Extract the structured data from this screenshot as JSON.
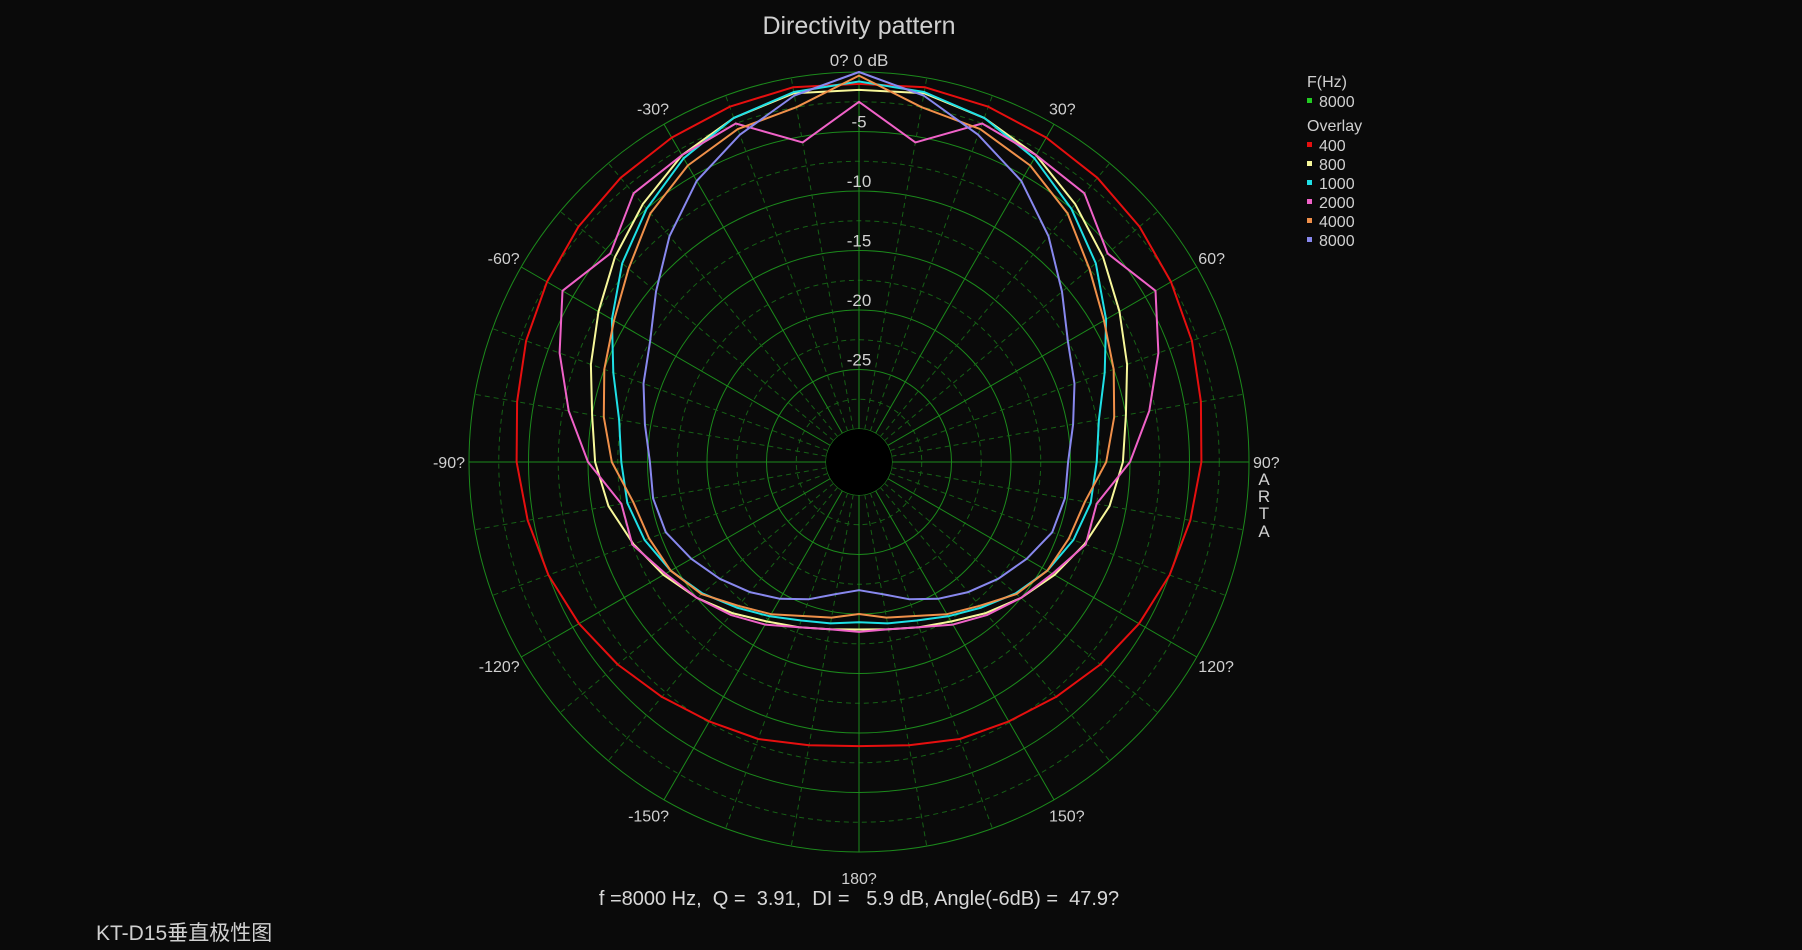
{
  "chart_data": {
    "type": "polar",
    "title": "Directivity pattern",
    "r_unit": "dB",
    "r_range": [
      -30,
      0
    ],
    "r_ticks": [
      0,
      -5,
      -10,
      -15,
      -20,
      -25
    ],
    "r_tick_labels": [
      "0? 0 dB",
      "-5",
      "-10",
      "-15",
      "-20",
      "-25"
    ],
    "angle_ticks": [
      -150,
      -120,
      -90,
      -60,
      -30,
      30,
      60,
      90,
      120,
      150,
      180
    ],
    "angle_tick_labels": [
      "-150?",
      "-120?",
      "-90?",
      "-60?",
      "-30?",
      "30?",
      "60?",
      "90?",
      "120?",
      "150?",
      "180?"
    ],
    "grid": true,
    "angles_deg": [
      0,
      10,
      20,
      30,
      40,
      50,
      60,
      70,
      80,
      90,
      100,
      110,
      120,
      130,
      140,
      150,
      160,
      170,
      180
    ],
    "series": [
      {
        "name": "400",
        "color": "#e60f0f",
        "values": [
          -1.0,
          -0.8,
          -1.0,
          -1.3,
          -1.6,
          -2.0,
          -2.5,
          -3.0,
          -3.6,
          -4.0,
          -4.5,
          -5.0,
          -5.6,
          -6.3,
          -7.0,
          -7.6,
          -8.0,
          -8.6,
          -8.9
        ]
      },
      {
        "name": "800",
        "color": "#f7f79a",
        "values": [
          -1.5,
          -1.3,
          -2.0,
          -3.0,
          -4.5,
          -6.0,
          -7.5,
          -8.8,
          -10.0,
          -10.6,
          -11.4,
          -12.6,
          -13.8,
          -15.0,
          -16.2,
          -17.3,
          -18.0,
          -18.5,
          -18.7
        ]
      },
      {
        "name": "1000",
        "color": "#1fe0e6",
        "values": [
          -0.8,
          -1.2,
          -2.0,
          -3.3,
          -5.0,
          -6.8,
          -8.8,
          -10.8,
          -12.3,
          -12.8,
          -13.0,
          -13.6,
          -14.5,
          -15.6,
          -16.8,
          -17.8,
          -18.6,
          -19.0,
          -19.3
        ]
      },
      {
        "name": "2000",
        "color": "#f062c8",
        "values": [
          -2.5,
          -5.5,
          -2.5,
          -3.0,
          -3.3,
          -5.5,
          -4.0,
          -6.0,
          -8.0,
          -10.0,
          -12.5,
          -12.5,
          -14.0,
          -15.0,
          -16.0,
          -17.0,
          -18.0,
          -18.5,
          -18.5
        ]
      },
      {
        "name": "4000",
        "color": "#f0904a",
        "values": [
          -0.3,
          -2.5,
          -3.0,
          -4.0,
          -5.5,
          -7.5,
          -9.0,
          -10.0,
          -11.0,
          -12.0,
          -13.5,
          -14.0,
          -14.5,
          -15.5,
          -17.0,
          -18.0,
          -19.0,
          -19.5,
          -20.0
        ]
      },
      {
        "name": "8000",
        "color": "#8888ee",
        "values": [
          0.0,
          -1.5,
          -3.5,
          -5.5,
          -8.0,
          -10.5,
          -12.5,
          -13.5,
          -14.5,
          -15.2,
          -15.2,
          -15.5,
          -16.5,
          -17.5,
          -18.5,
          -19.5,
          -20.5,
          -21.5,
          -22.0
        ]
      }
    ],
    "legend": {
      "header": "F(Hz)",
      "current": {
        "label": "8000",
        "color": "#22cc22"
      },
      "overlay_header": "Overlay",
      "overlay_items": [
        {
          "label": "400",
          "color": "#e60f0f"
        },
        {
          "label": "800",
          "color": "#f7f79a"
        },
        {
          "label": "1000",
          "color": "#1fe0e6"
        },
        {
          "label": "2000",
          "color": "#f062c8"
        },
        {
          "label": "4000",
          "color": "#f0904a"
        },
        {
          "label": "8000",
          "color": "#8888ee"
        }
      ]
    }
  },
  "brand_letters": [
    "A",
    "R",
    "T",
    "A"
  ],
  "footer_text": "f =8000 Hz,  Q =  3.91,  DI =   5.9 dB, Angle(-6dB) =  47.9?",
  "caption": "KT-D15垂直极性图",
  "colors": {
    "background": "#0a0a0a",
    "grid_major": "#1c8a1c",
    "grid_minor": "#166016",
    "text": "#d0d0d0"
  }
}
